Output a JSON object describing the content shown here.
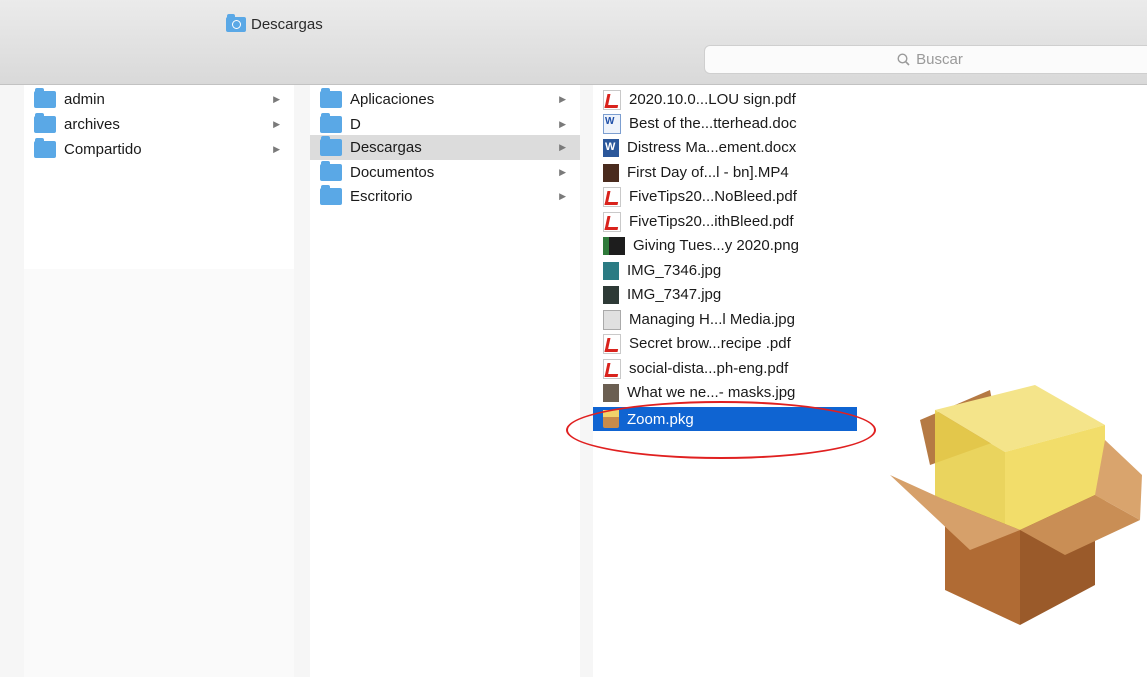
{
  "window": {
    "title": "Descargas"
  },
  "search": {
    "placeholder": "Buscar"
  },
  "column1": {
    "items": [
      {
        "label": "admin"
      },
      {
        "label": "archives"
      },
      {
        "label": "Compartido"
      }
    ]
  },
  "column2": {
    "items": [
      {
        "label": "Aplicaciones",
        "icon": "applications-folder-icon"
      },
      {
        "label": "D",
        "icon": "folder-icon"
      },
      {
        "label": "Descargas",
        "icon": "downloads-folder-icon"
      },
      {
        "label": "Documentos",
        "icon": "documents-folder-icon"
      },
      {
        "label": "Escritorio",
        "icon": "desktop-folder-icon"
      }
    ],
    "selected": "Descargas"
  },
  "column3": {
    "files": [
      {
        "label": "2020.10.0...LOU sign.pdf",
        "icon": "pdf-icon"
      },
      {
        "label": "Best of the...tterhead.doc",
        "icon": "word-doc-icon"
      },
      {
        "label": "Distress Ma...ement.docx",
        "icon": "word-docx-icon"
      },
      {
        "label": "First Day of...l -  bn].MP4",
        "icon": "video-icon"
      },
      {
        "label": "FiveTips20...NoBleed.pdf",
        "icon": "pdf-icon"
      },
      {
        "label": "FiveTips20...ithBleed.pdf",
        "icon": "pdf-icon"
      },
      {
        "label": "Giving Tues...y 2020.png",
        "icon": "image-icon"
      },
      {
        "label": "IMG_7346.jpg",
        "icon": "image-icon"
      },
      {
        "label": "IMG_7347.jpg",
        "icon": "image-icon"
      },
      {
        "label": "Managing H...l Media.jpg",
        "icon": "image-icon"
      },
      {
        "label": "Secret brow...recipe .pdf",
        "icon": "pdf-icon"
      },
      {
        "label": "social-dista...ph-eng.pdf",
        "icon": "pdf-icon"
      },
      {
        "label": "What we ne...- masks.jpg",
        "icon": "image-icon"
      },
      {
        "label": "Zoom.pkg",
        "icon": "package-icon"
      }
    ],
    "selected": "Zoom.pkg"
  },
  "preview": {
    "icon": "package-preview-icon"
  },
  "colors": {
    "selection": "#0f64d2",
    "folder": "#5aa8e6",
    "annotation": "#e02020"
  }
}
